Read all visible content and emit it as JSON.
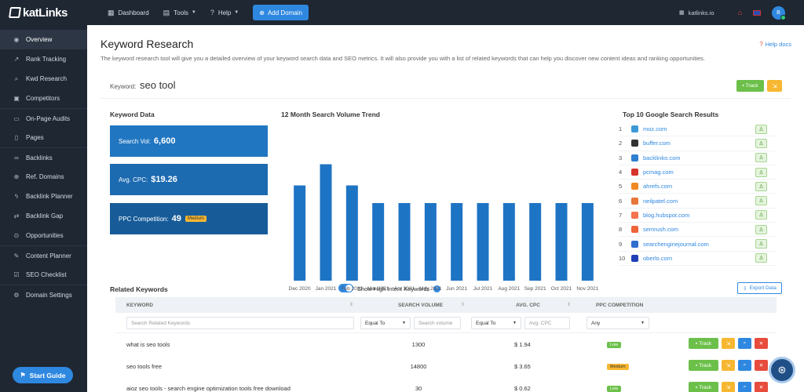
{
  "brand": {
    "name": "katLinks"
  },
  "sidebar": {
    "items": [
      {
        "label": "Overview",
        "icon": "dashboard-icon",
        "glyph": "◉"
      },
      {
        "label": "Rank Tracking",
        "icon": "chart-icon",
        "glyph": "↗"
      },
      {
        "label": "Kwd Research",
        "icon": "search-icon",
        "glyph": "⌕"
      },
      {
        "label": "Competitors",
        "icon": "users-icon",
        "glyph": "▣"
      },
      {
        "label": "On-Page Audits",
        "icon": "audit-icon",
        "glyph": "▭"
      },
      {
        "label": "Pages",
        "icon": "pages-icon",
        "glyph": "▯"
      },
      {
        "label": "Backlinks",
        "icon": "link-icon",
        "glyph": "∞"
      },
      {
        "label": "Ref. Domains",
        "icon": "globe-icon",
        "glyph": "⊕"
      },
      {
        "label": "Backlink Planner",
        "icon": "bolt-icon",
        "glyph": "ϟ"
      },
      {
        "label": "Backlink Gap",
        "icon": "gap-icon",
        "glyph": "⇄"
      },
      {
        "label": "Opportunities",
        "icon": "target-icon",
        "glyph": "⊙"
      },
      {
        "label": "Content Planner",
        "icon": "pencil-icon",
        "glyph": "✎"
      },
      {
        "label": "SEO Checklist",
        "icon": "checklist-icon",
        "glyph": "☑"
      },
      {
        "label": "Domain Settings",
        "icon": "gear-icon",
        "glyph": "⚙"
      }
    ],
    "start_guide": "Start Guide"
  },
  "topbar": {
    "dashboard": "Dashboard",
    "tools": "Tools",
    "help": "Help",
    "add_domain": "Add Domain",
    "site": "katlinks.io",
    "avatar_initial": "B"
  },
  "page": {
    "title": "Keyword Research",
    "help_docs": "Help docs",
    "description": "The keyword research tool will give you a detailed overview of your keyword search data and SEO metrics. It will also provide you with a list of related keywords that can help you discover new content ideas and ranking opportunities."
  },
  "keyword": {
    "label": "Keyword:",
    "value": "seo tool",
    "track": "Track"
  },
  "keyword_data": {
    "title": "Keyword Data",
    "search_vol_label": "Search Vol:",
    "search_vol": "6,600",
    "cpc_label": "Avg. CPC:",
    "cpc": "$19.26",
    "ppc_label": "PPC Competition:",
    "ppc": "49",
    "ppc_level": "Medium"
  },
  "trend_title": "12 Month Search Volume Trend",
  "chart_data": {
    "type": "bar",
    "title": "12 Month Search Volume Trend",
    "categories": [
      "Dec 2020",
      "Jan 2021",
      "Feb 2021",
      "Mar 2021",
      "Apr 2021",
      "May 2021",
      "Jun 2021",
      "Jul 2021",
      "Aug 2021",
      "Sep 2021",
      "Oct 2021",
      "Nov 2021"
    ],
    "values": [
      8100,
      9900,
      8100,
      6600,
      6600,
      6600,
      6600,
      6600,
      6600,
      6600,
      6600,
      6600
    ],
    "ylim": [
      0,
      10000
    ],
    "grid": false,
    "color": "#1e74c4"
  },
  "top10": {
    "title": "Top 10 Google Search Results",
    "results": [
      {
        "rank": "1",
        "domain": "moz.com",
        "color": "#3d9ad6"
      },
      {
        "rank": "2",
        "domain": "buffer.com",
        "color": "#333333"
      },
      {
        "rank": "3",
        "domain": "backlinko.com",
        "color": "#2e7ecf"
      },
      {
        "rank": "4",
        "domain": "pcmag.com",
        "color": "#d6332b"
      },
      {
        "rank": "5",
        "domain": "ahrefs.com",
        "color": "#f08a24"
      },
      {
        "rank": "6",
        "domain": "neilpatel.com",
        "color": "#e8773a"
      },
      {
        "rank": "7",
        "domain": "blog.hubspot.com",
        "color": "#f5734f"
      },
      {
        "rank": "8",
        "domain": "semrush.com",
        "color": "#f0643a"
      },
      {
        "rank": "9",
        "domain": "searchenginejournal.com",
        "color": "#2f6fcf"
      },
      {
        "rank": "10",
        "domain": "oberlo.com",
        "color": "#1f3fb5"
      }
    ]
  },
  "related": {
    "title": "Related Keywords",
    "toggle_label": "Show High Intent Keywords",
    "export": "Export Data",
    "headers": {
      "keyword": "KEYWORD",
      "volume": "SEARCH VOLUME",
      "cpc": "AVG. CPC",
      "ppc": "PPC COMPETITION"
    },
    "filters": {
      "keyword_placeholder": "Search Related Keywords",
      "volume_op": "Equal To",
      "volume_placeholder": "Search volume",
      "cpc_op": "Equal To",
      "cpc_placeholder": "Avg. CPC",
      "ppc_any": "Any"
    },
    "rows": [
      {
        "keyword": "what is seo tools",
        "volume": "1300",
        "cpc": "$ 1.94",
        "ppc": "Low"
      },
      {
        "keyword": "seo tools free",
        "volume": "14800",
        "cpc": "$ 3.65",
        "ppc": "Medium"
      },
      {
        "keyword": "aioz seo tools - search engine optimization tools free download",
        "volume": "30",
        "cpc": "$ 0.62",
        "ppc": "Low"
      }
    ],
    "track": "Track"
  }
}
